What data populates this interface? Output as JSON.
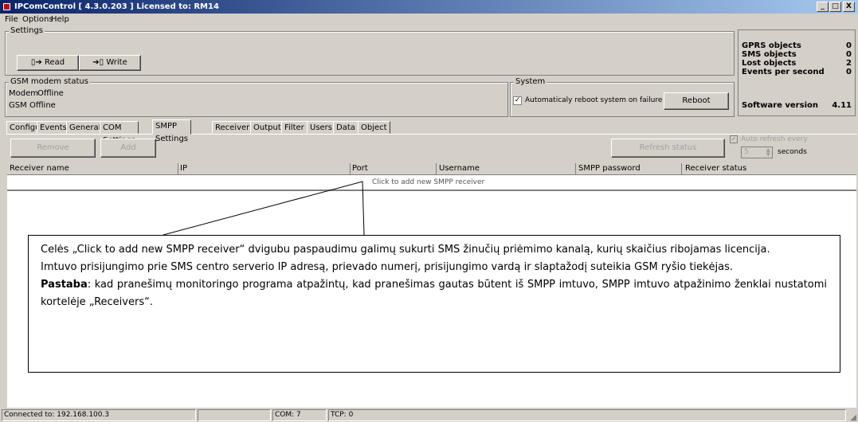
{
  "window": {
    "title": "IPComControl [ 4.3.0.203 ]  Licensed to: RM14",
    "minimize": "_",
    "maximize": "□",
    "close": "X"
  },
  "menu": [
    "File",
    "Options",
    "Help"
  ],
  "settings": {
    "title": "Settings",
    "read_label": "Read",
    "write_label": "Write"
  },
  "gsm": {
    "title": "GSM modem status",
    "modem_label": "Modem",
    "modem_value": "Offline",
    "gsm_label": "GSM",
    "gsm_value": "Offline"
  },
  "system": {
    "title": "System",
    "auto_reboot_label": "Automaticaly reboot system on failure",
    "auto_reboot_checked": true,
    "reboot_label": "Reboot"
  },
  "stats": {
    "gprs_label": "GPRS objects",
    "gprs_value": "0",
    "sms_label": "SMS objects",
    "sms_value": "0",
    "lost_label": "Lost objects",
    "lost_value": "2",
    "events_label": "Events per second",
    "events_value": "0",
    "version_label": "Software version",
    "version_value": "4.11"
  },
  "tabs": [
    "Configure",
    "Events",
    "General",
    "COM Settings",
    "SMPP Settings",
    "Receivers",
    "Outputs",
    "Filter",
    "Users",
    "Data",
    "Object"
  ],
  "active_tab": "SMPP Settings",
  "toolbar": {
    "remove_label": "Remove",
    "add_label": "Add",
    "refresh_label": "Refresh status",
    "auto_refresh_label": "Auto refresh every",
    "auto_refresh_value": "5",
    "seconds_label": "seconds"
  },
  "grid": {
    "columns": [
      "Receiver name",
      "IP",
      "Port",
      "Username",
      "SMPP password",
      "Receiver status"
    ],
    "add_row_text": "Click to add new SMPP receiver"
  },
  "callout": {
    "p1": "Celės „Click to add new SMPP receiver“ dvigubu paspaudimu galimų sukurti SMS žinučių priėmimo kanalą, kurių skaičius ribojamas licencija.",
    "p2": "Imtuvo prisijungimo prie SMS centro serverio IP adresą, prievado numerį, prisijungimo vardą ir slaptažodį suteikia GSM ryšio tiekėjas.",
    "p3_bold": "Pastaba",
    "p3_rest": ": kad pranešimų monitoringo programa atpažintų, kad pranešimas gautas būtent iš SMPP imtuvo, SMPP imtuvo atpažinimo ženklai nustatomi kortelėje „Receivers“."
  },
  "status": {
    "connection": "Connected to: 192.168.100.3",
    "com": "COM: 7",
    "tcp": "TCP: 0"
  }
}
